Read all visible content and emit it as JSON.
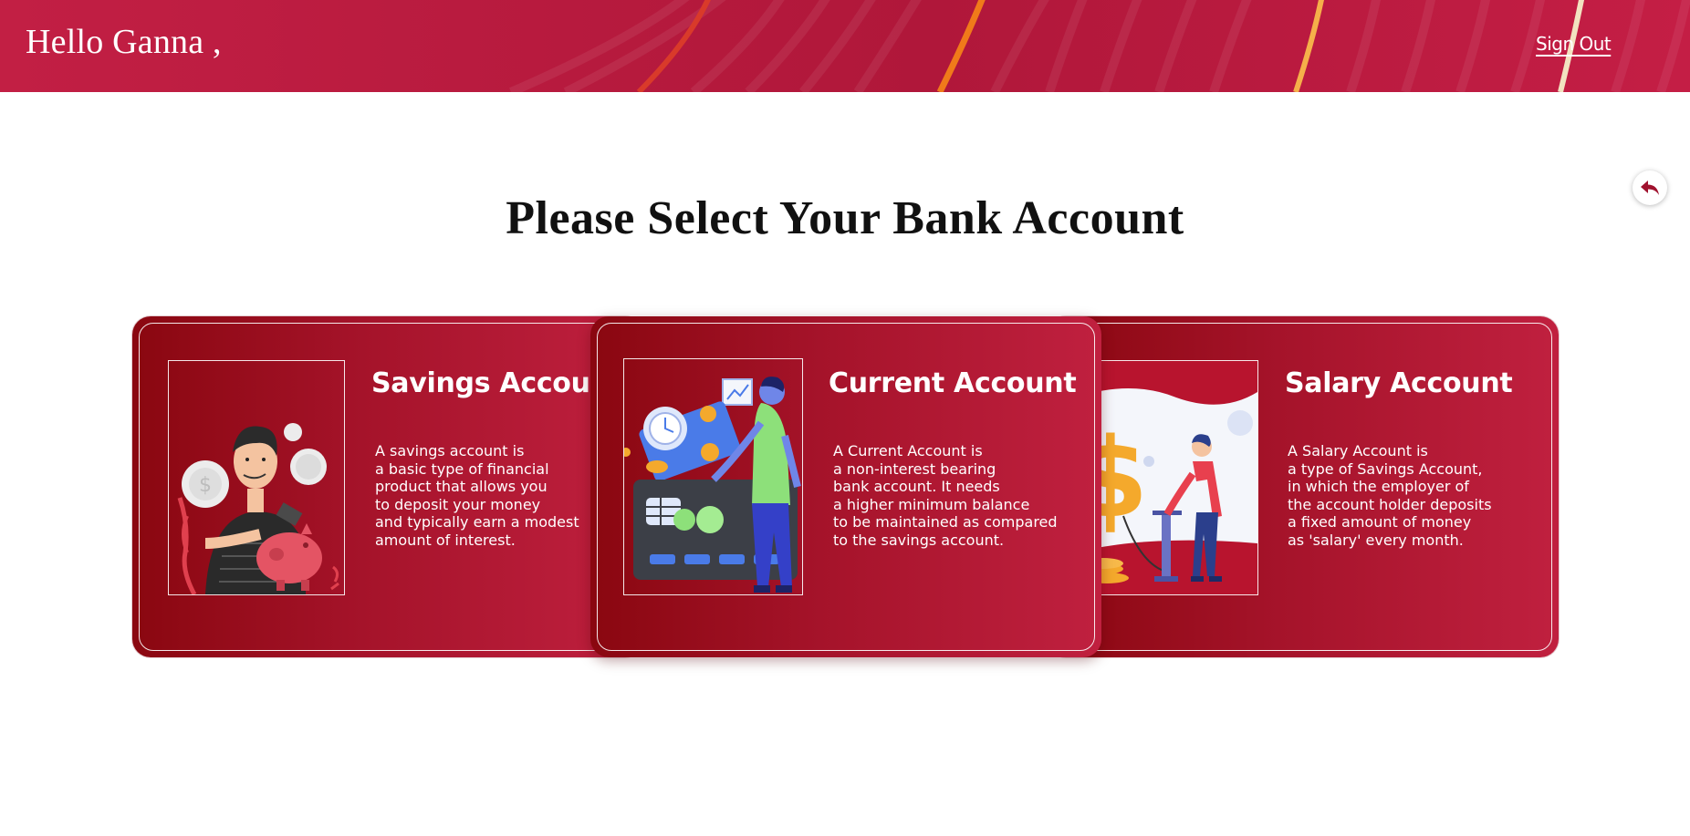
{
  "header": {
    "greeting": "Hello Ganna ,",
    "signout_label": "Sign Out"
  },
  "page": {
    "title": "Please Select Your Bank Account"
  },
  "accounts": [
    {
      "title": "Savings Account",
      "description": "A savings account is\na basic type of financial\nproduct that allows you\nto deposit your money\nand typically earn a modest\namount of interest."
    },
    {
      "title": "Current Account",
      "description": "A Current Account is\na non-interest bearing\nbank account. It needs\na higher minimum balance\nto be maintained as compared\nto the savings account."
    },
    {
      "title": "Salary Account",
      "description": "A Salary Account is\na type of Savings Account,\nin which the employer of\nthe account holder deposits\na fixed amount of money\nas 'salary' every month."
    }
  ],
  "icons": {
    "back": "back-arrow-icon"
  },
  "colors": {
    "brand": "#c21f44",
    "card_dark": "#8a0710",
    "card_light": "#c0203f"
  }
}
